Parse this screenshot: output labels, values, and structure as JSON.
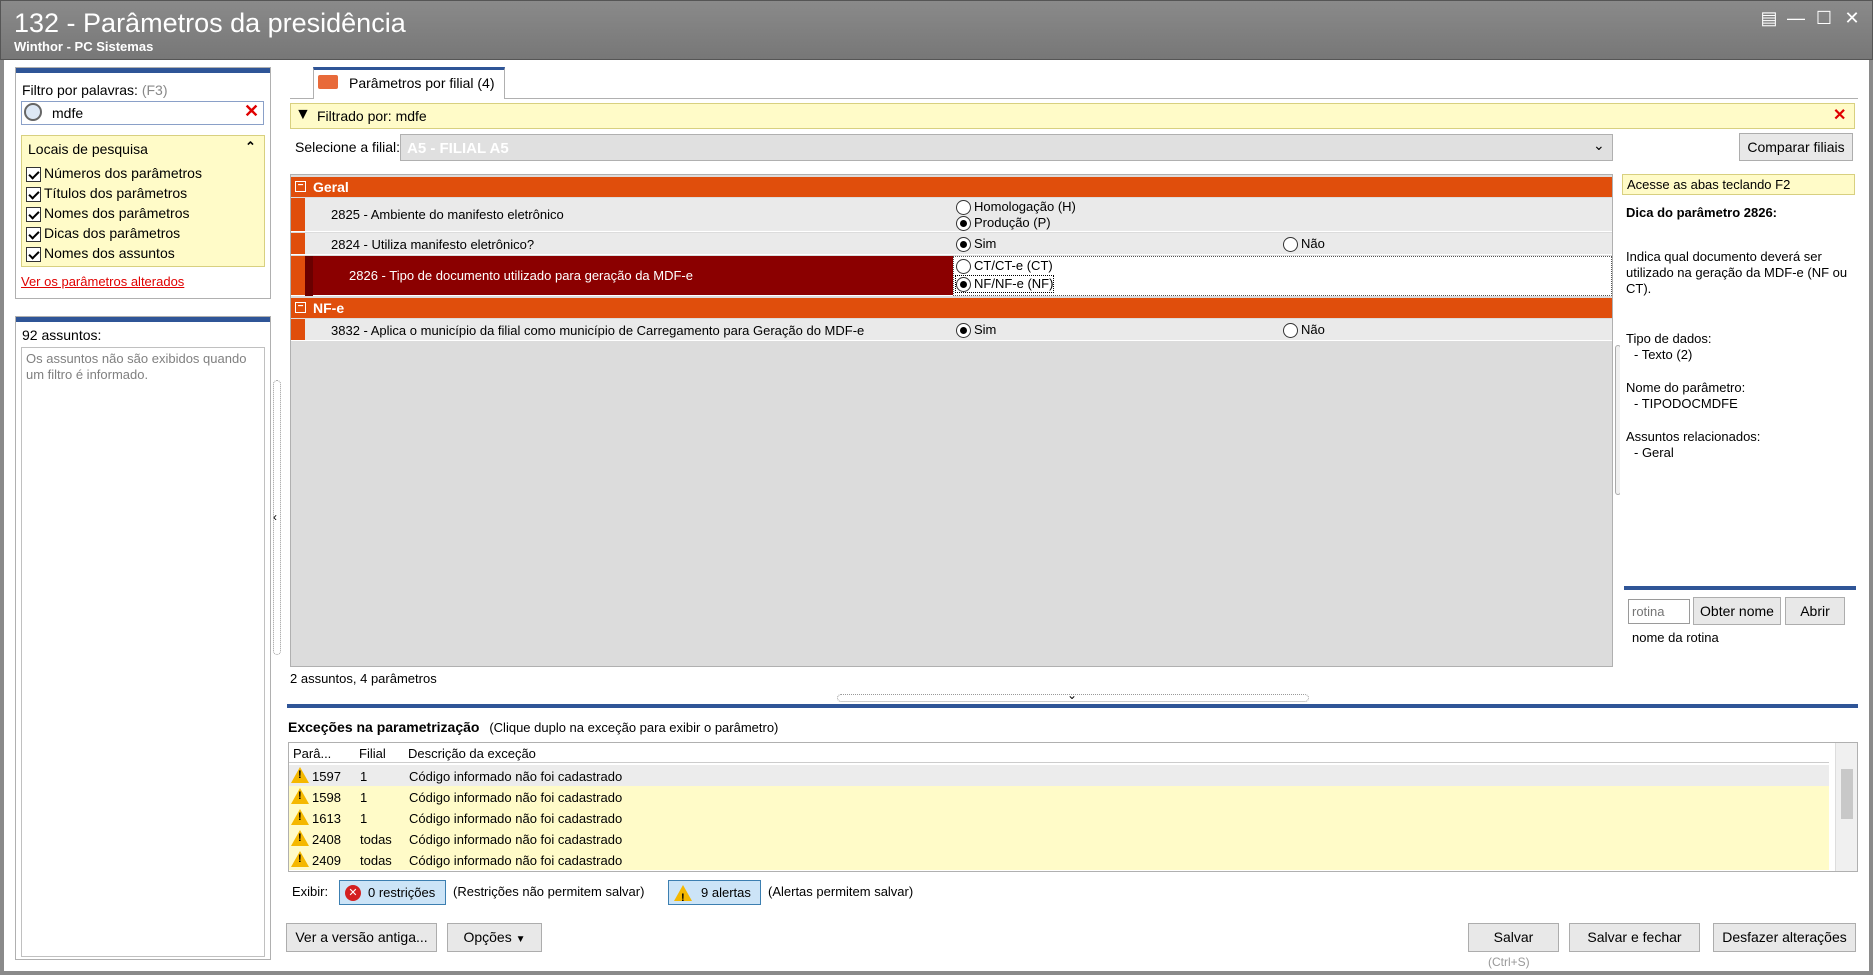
{
  "window": {
    "title": "132 - Parâmetros da presidência",
    "subtitle": "Winthor - PC Sistemas"
  },
  "left": {
    "filter_label": "Filtro por palavras:",
    "filter_shortcut": "(F3)",
    "search_value": "mdfe",
    "locais_title": "Locais de pesquisa",
    "locais": [
      {
        "label": "Números dos parâmetros",
        "checked": true
      },
      {
        "label": "Títulos dos parâmetros",
        "checked": true
      },
      {
        "label": "Nomes dos parâmetros",
        "checked": true
      },
      {
        "label": "Dicas dos parâmetros",
        "checked": true
      },
      {
        "label": "Nomes dos assuntos",
        "checked": true
      }
    ],
    "link_alterados": "Ver os parâmetros alterados",
    "assuntos_count": "92 assuntos:",
    "assuntos_msg": "Os assuntos não são exibidos quando um filtro é informado."
  },
  "tab": {
    "label": "Parâmetros por filial",
    "count": "(4)"
  },
  "filter_bar": {
    "text": "Filtrado por: mdfe"
  },
  "filial": {
    "label": "Selecione a filial:",
    "value": "A5 - FILIAL A5",
    "compare_button": "Comparar filiais"
  },
  "groups": [
    {
      "name": "Geral"
    },
    {
      "name": "NF-e"
    }
  ],
  "params": [
    {
      "label": "2825 - Ambiente do manifesto eletrônico",
      "opt1": "Homologação (H)",
      "opt2": "Produção (P)"
    },
    {
      "label": "2824 - Utiliza manifesto eletrônico?",
      "opt1": "Sim",
      "opt2": "Não"
    },
    {
      "label": "2826 - Tipo de documento utilizado para geração da MDF-e",
      "opt1": "CT/CT-e (CT)",
      "opt2": "NF/NF-e (NF)"
    },
    {
      "label": "3832 - Aplica o município da filial como município de Carregamento para Geração do MDF-e",
      "opt1": "Sim",
      "opt2": "Não"
    }
  ],
  "grid_status": "2 assuntos, 4 parâmetros",
  "right": {
    "hint": "Acesse as abas teclando F2",
    "dica_title": "Dica do parâmetro 2826:",
    "dica_text": "Indica qual documento deverá ser utilizado na geração da MDF-e (NF ou CT).",
    "tipo_label": "Tipo de dados:",
    "tipo_value": "- Texto (2)",
    "nome_label": "Nome do parâmetro:",
    "nome_value": "- TIPODOCMDFE",
    "assuntos_label": "Assuntos relacionados:",
    "assuntos_value": "- Geral",
    "rotina_placeholder": "rotina",
    "obter_button": "Obter nome",
    "abrir_button": "Abrir",
    "nome_rotina": "nome da rotina"
  },
  "exceptions": {
    "title": "Exceções na parametrização",
    "subtitle": "(Clique duplo na exceção para exibir o parâmetro)",
    "columns": [
      "Parâ...",
      "Filial",
      "Descrição da exceção"
    ],
    "rows": [
      {
        "param": "1597",
        "filial": "1",
        "desc": "Código informado não foi cadastrado"
      },
      {
        "param": "1598",
        "filial": "1",
        "desc": "Código informado não foi cadastrado"
      },
      {
        "param": "1613",
        "filial": "1",
        "desc": "Código informado não foi cadastrado"
      },
      {
        "param": "2408",
        "filial": "todas",
        "desc": "Código informado não foi cadastrado"
      },
      {
        "param": "2409",
        "filial": "todas",
        "desc": "Código informado não foi cadastrado"
      }
    ],
    "exibir_label": "Exibir:",
    "restricoes_button": "0 restrições",
    "restricoes_note": "(Restrições não permitem salvar)",
    "alertas_button": "9 alertas",
    "alertas_note": "(Alertas permitem salvar)"
  },
  "footer": {
    "versao_button": "Ver a versão antiga...",
    "opcoes_button": "Opções",
    "salvar_button": "Salvar",
    "salvar_shortcut": "(Ctrl+S)",
    "salvar_fechar_button": "Salvar e fechar",
    "desfazer_button": "Desfazer alterações"
  },
  "colors": {
    "accent_orange": "#e04e0c",
    "selected_row": "#8b0000",
    "highlight_yellow": "#fffbc8",
    "titlebar": "#808080"
  }
}
